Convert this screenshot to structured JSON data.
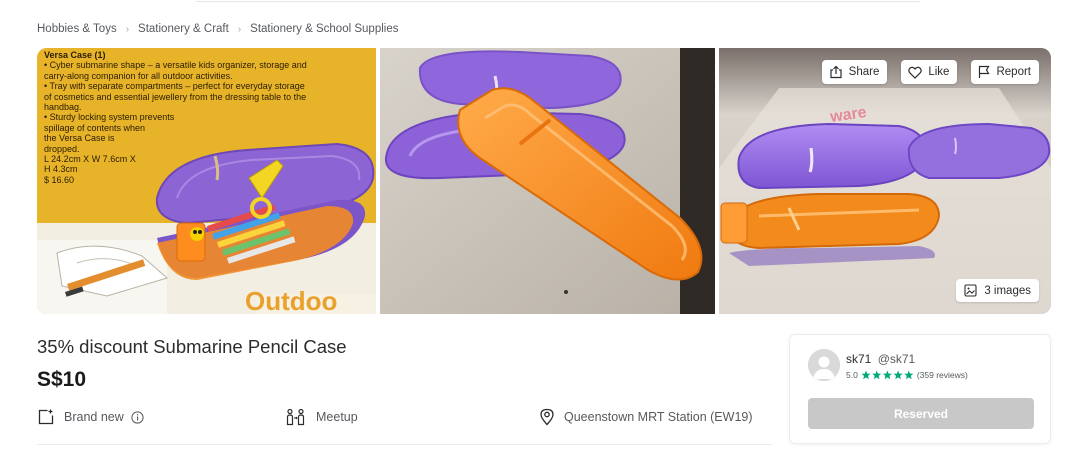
{
  "breadcrumb": [
    "Hobbies & Toys",
    "Stationery & Craft",
    "Stationery & School Supplies"
  ],
  "gallery": {
    "photo1": {
      "title": "Versa Case (1)",
      "lines": [
        "• Cyber submarine shape – a versatile kids organizer, storage and",
        "   carry-along companion for all outdoor activities.",
        "• Tray with separate compartments – perfect for everyday storage",
        "   of cosmetics and essential jewellery from the dressing table to the",
        "   handbag.",
        "• Sturdy locking system prevents",
        "   spillage of contents when",
        "   the Versa Case is",
        "   dropped.",
        "L 24.2cm X W 7.6cm X",
        "H 4.3cm",
        "$ 16.60"
      ],
      "banner": "Outdoo"
    },
    "photo3_brand": "ware",
    "share_label": "Share",
    "like_label": "Like",
    "report_label": "Report",
    "image_count_label": "3 images"
  },
  "listing": {
    "title": "35% discount Submarine Pencil Case",
    "price": "S$10",
    "condition": "Brand new",
    "deal_method": "Meetup",
    "location": "Queenstown MRT Station (EW19)"
  },
  "seller": {
    "name": "sk71",
    "handle": "@sk71",
    "rating": "5.0",
    "reviews": "(359 reviews)",
    "star_color": "#00a97a"
  },
  "action": {
    "reserved_label": "Reserved"
  },
  "colors": {
    "reserved_bg": "#c8c8c8",
    "case_purple": "#8c63d8",
    "case_orange": "#f28a1c"
  }
}
